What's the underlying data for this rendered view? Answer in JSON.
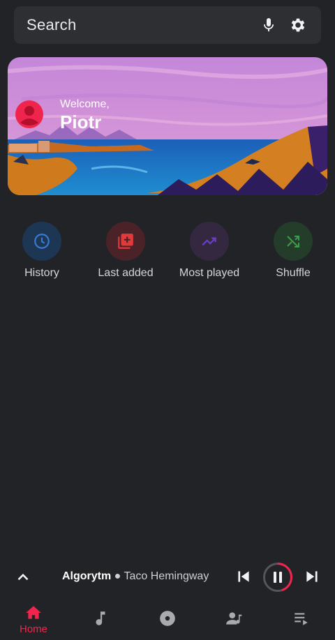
{
  "search": {
    "placeholder": "Search",
    "mic_icon": "microphone-icon",
    "settings_icon": "gear-icon"
  },
  "banner": {
    "greeting": "Welcome,",
    "user_name": "Piotr",
    "avatar_icon": "user-avatar-icon"
  },
  "quick_actions": [
    {
      "label": "History",
      "icon": "clock-icon",
      "color": "#3a6cc0"
    },
    {
      "label": "Last added",
      "icon": "library-add-icon",
      "color": "#e03a3a"
    },
    {
      "label": "Most played",
      "icon": "trending-up-icon",
      "color": "#6a3cc0"
    },
    {
      "label": "Shuffle",
      "icon": "shuffle-icon",
      "color": "#3f9a4a"
    }
  ],
  "player": {
    "title": "Algorytm",
    "separator": " ● ",
    "artist": "Taco Hemingway",
    "progress": 0.45
  },
  "nav": {
    "home_label": "Home",
    "items": [
      "home-icon",
      "music-note-icon",
      "album-disc-icon",
      "artist-icon",
      "playlist-icon"
    ]
  },
  "colors": {
    "accent": "#f0254d",
    "background": "#222326"
  }
}
